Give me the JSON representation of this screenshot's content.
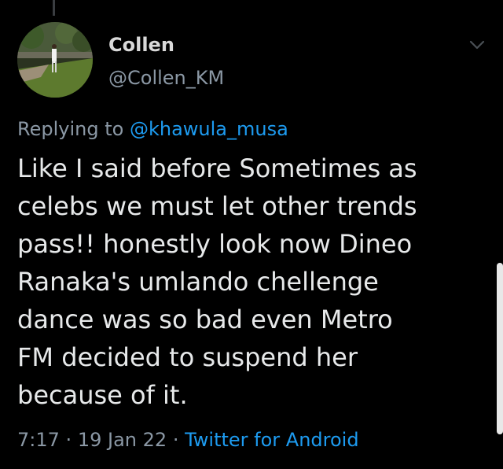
{
  "author": {
    "display_name": "Collen",
    "handle": "@Collen_KM",
    "avatar_icon": "profile-photo"
  },
  "reply": {
    "prefix": "Replying to",
    "mention": "@khawula_musa"
  },
  "tweet": {
    "lines": [
      "Like I said before Sometimes as",
      "celebs we must let other trends",
      "pass!! honestly look now Dineo",
      "Ranaka's umlando chellenge",
      "dance was so bad even Metro",
      "FM decided to suspend her",
      "because of it."
    ]
  },
  "meta": {
    "time": "7:17",
    "separator": "·",
    "date": "19 Jan 22",
    "source": "Twitter for Android"
  },
  "colors": {
    "background": "#000000",
    "text": "#e7e9ea",
    "secondary": "#8b98a5",
    "accent": "#1d9bf0"
  },
  "icons": {
    "menu": "chevron-down-icon"
  }
}
